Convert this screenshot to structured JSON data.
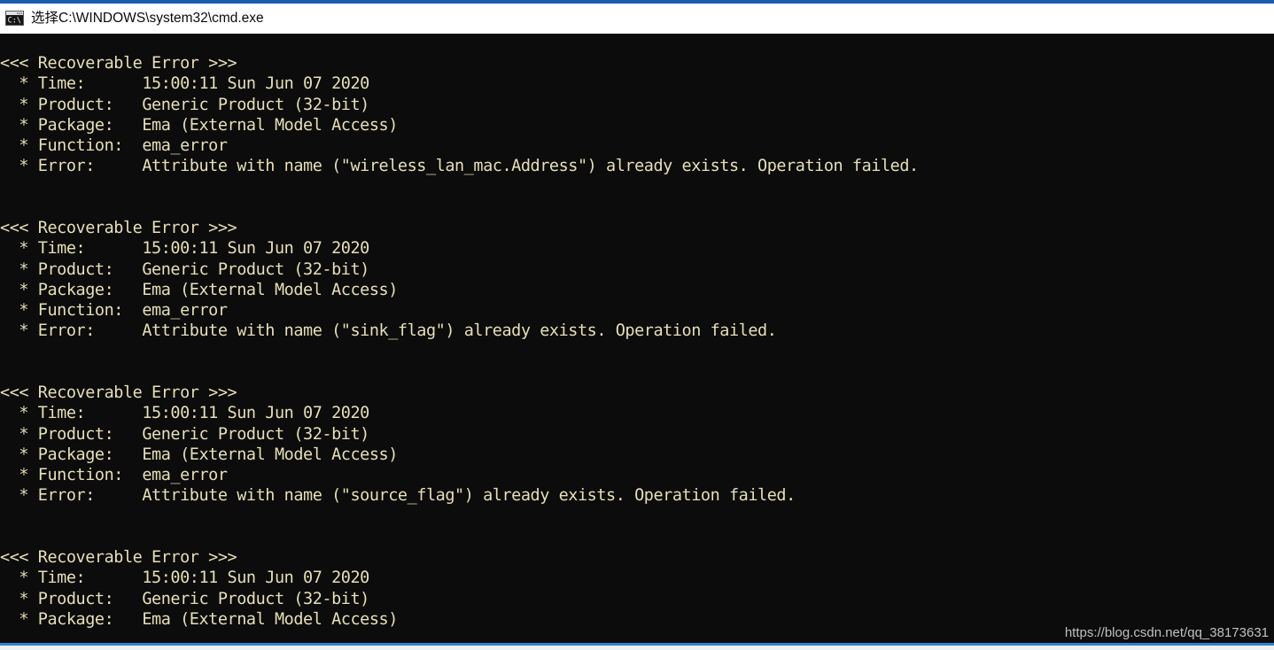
{
  "window": {
    "title": "选择C:\\WINDOWS\\system32\\cmd.exe",
    "icon": "cmd-console-icon",
    "accent_color": "#1a5cb0",
    "background_color": "#0c0c0c",
    "text_color": "#e6dfb8"
  },
  "console": {
    "header_open": "<<<",
    "header_label": "Recoverable Error",
    "header_close": ">>>",
    "labels": {
      "time": "  * Time:",
      "product": "  * Product:",
      "package": "  * Package:",
      "function": "  * Function:",
      "error": "  * Error:"
    },
    "blocks": [
      {
        "header": "<<< Recoverable Error >>>",
        "time": "  * Time:      15:00:11 Sun Jun 07 2020",
        "product": "  * Product:   Generic Product (32-bit)",
        "package": "  * Package:   Ema (External Model Access)",
        "function": "  * Function:  ema_error",
        "error": "  * Error:     Attribute with name (\"wireless_lan_mac.Address\") already exists. Operation failed."
      },
      {
        "header": "<<< Recoverable Error >>>",
        "time": "  * Time:      15:00:11 Sun Jun 07 2020",
        "product": "  * Product:   Generic Product (32-bit)",
        "package": "  * Package:   Ema (External Model Access)",
        "function": "  * Function:  ema_error",
        "error": "  * Error:     Attribute with name (\"sink_flag\") already exists. Operation failed."
      },
      {
        "header": "<<< Recoverable Error >>>",
        "time": "  * Time:      15:00:11 Sun Jun 07 2020",
        "product": "  * Product:   Generic Product (32-bit)",
        "package": "  * Package:   Ema (External Model Access)",
        "function": "  * Function:  ema_error",
        "error": "  * Error:     Attribute with name (\"source_flag\") already exists. Operation failed."
      },
      {
        "header": "<<< Recoverable Error >>>",
        "time": "  * Time:      15:00:11 Sun Jun 07 2020",
        "product": "  * Product:   Generic Product (32-bit)",
        "package": "  * Package:   Ema (External Model Access)",
        "function": "",
        "error": ""
      }
    ]
  },
  "watermark": {
    "text": "https://blog.csdn.net/qq_38173631"
  }
}
